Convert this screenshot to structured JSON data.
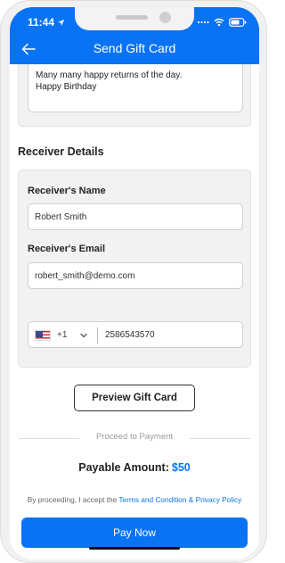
{
  "status_bar": {
    "time": "11:44",
    "location_icon": "location-arrow-icon",
    "signal_icon": "signal-dots-icon",
    "wifi_icon": "wifi-icon",
    "battery_icon": "battery-icon"
  },
  "header": {
    "title": "Send Gift Card",
    "back_icon": "arrow-left-icon"
  },
  "message": {
    "line1": "Many many happy returns of the day.",
    "line2": "Happy Birthday"
  },
  "receiver": {
    "section_title": "Receiver Details",
    "name_label": "Receiver's Name",
    "name_value": "Robert Smith",
    "email_label": "Receiver's Email",
    "email_value": "robert_smith@demo.com",
    "phone_country_code": "+1",
    "phone_flag_icon": "us-flag-icon",
    "phone_number": "2586543570"
  },
  "actions": {
    "preview_label": "Preview Gift Card",
    "proceed_label": "Proceed to Payment",
    "pay_label": "Pay Now"
  },
  "payment": {
    "payable_label": "Payable Amount:",
    "amount": "$50"
  },
  "consent": {
    "prefix": "By proceeding, I accept the ",
    "link_text": "Terms and Condition & Privacy Policy"
  },
  "colors": {
    "accent": "#0a73f4",
    "card_bg": "#f2f2f2"
  }
}
